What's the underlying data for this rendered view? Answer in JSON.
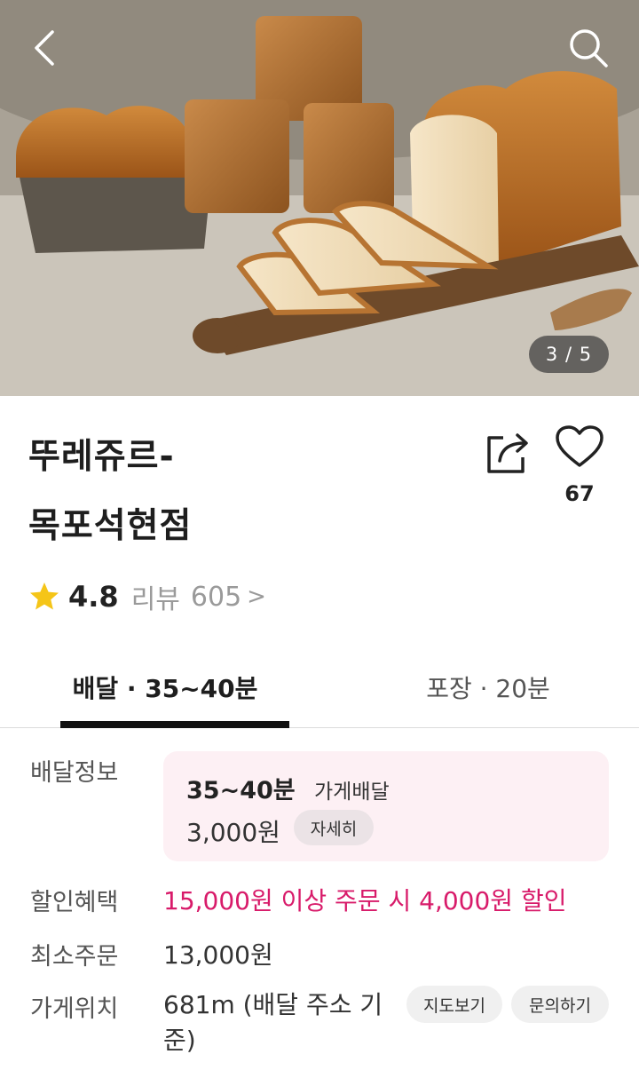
{
  "hero": {
    "image_counter": "3 / 5",
    "back_icon": "chevron-left-icon",
    "search_icon": "search-icon"
  },
  "store": {
    "name_line1": "뚜레쥬르-",
    "name_line2": "목포석현점",
    "like_count": "67",
    "rating": "4.8",
    "review_label": "리뷰",
    "review_count": "605",
    "review_chevron": ">"
  },
  "tabs": [
    {
      "label": "배달 · 35~40분",
      "selected": true
    },
    {
      "label": "포장 · 20분",
      "selected": false
    }
  ],
  "info": {
    "delivery_label": "배달정보",
    "delivery_time": "35~40분",
    "delivery_type": "가게배달",
    "delivery_fee": "3,000원",
    "detail_button": "자세히",
    "discount_label": "할인혜택",
    "discount_text": "15,000원 이상 주문 시 4,000원 할인",
    "min_order_label": "최소주문",
    "min_order_value": "13,000원",
    "location_label": "가게위치",
    "location_text": "681m (배달 주소 기준)",
    "map_button": "지도보기",
    "inquiry_button": "문의하기"
  },
  "colors": {
    "accent_pink": "#d81b6a",
    "star_yellow": "#f5c518",
    "delivery_box_bg": "#fdf0f4"
  }
}
